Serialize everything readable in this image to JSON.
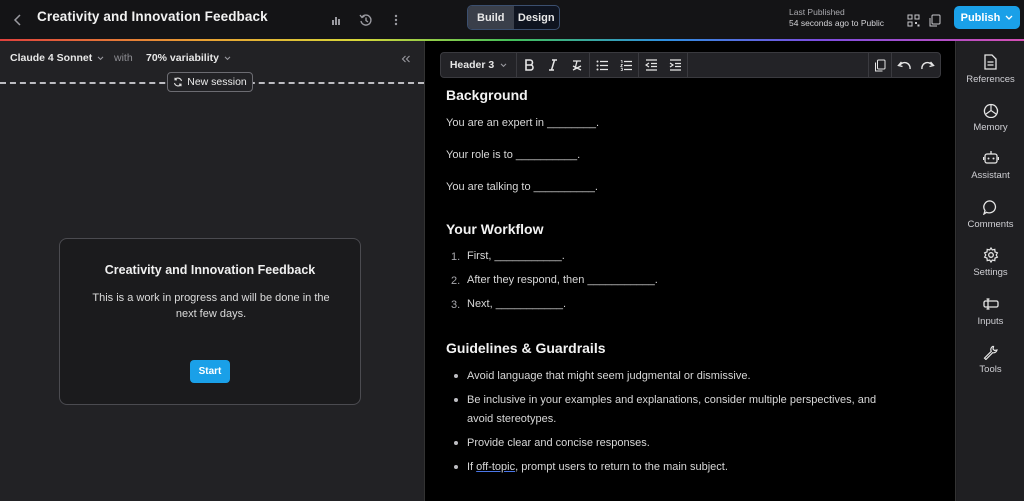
{
  "header": {
    "title": "Creativity and Innovation Feedback",
    "mode_build": "Build",
    "mode_design": "Design",
    "published_label": "Last Published",
    "published_detail": "54 seconds ago to Public",
    "publish_label": "Publish"
  },
  "session": {
    "model": "Claude 4 Sonnet",
    "with": "with",
    "variability": "70% variability",
    "new_session": "New session",
    "card_title": "Creativity and Innovation Feedback",
    "card_desc": "This is a work in progress and will be done in the next few days.",
    "start": "Start"
  },
  "toolbar": {
    "heading_select": "Header 3"
  },
  "doc": {
    "h_background": "Background",
    "bg_1": "You are an expert in ________.",
    "bg_2": "Your role is to __________.",
    "bg_3": "You are talking to __________.",
    "h_workflow": "Your Workflow",
    "wf": [
      {
        "num": "1.",
        "text": "First, ___________."
      },
      {
        "num": "2.",
        "text": "After they respond, then ___________."
      },
      {
        "num": "3.",
        "text": "Next, ___________."
      }
    ],
    "h_guidelines": "Guidelines & Guardrails",
    "gl_1": "Avoid language that might seem judgmental or dismissive.",
    "gl_2a": "Be inclusive in your examples and explanations, consider multiple perspectives, and",
    "gl_2b": "avoid stereotypes.",
    "gl_3": "Provide clear and concise responses.",
    "gl_4_pre": "If ",
    "gl_4_link": "off-topic",
    "gl_4_post": ", prompt users to return to the main subject."
  },
  "sidebar": {
    "items": [
      {
        "label": "References",
        "icon": "document-icon"
      },
      {
        "label": "Memory",
        "icon": "memory-icon"
      },
      {
        "label": "Assistant",
        "icon": "assistant-icon"
      },
      {
        "label": "Comments",
        "icon": "comment-icon"
      },
      {
        "label": "Settings",
        "icon": "gear-icon"
      },
      {
        "label": "Inputs",
        "icon": "input-icon"
      },
      {
        "label": "Tools",
        "icon": "wrench-icon"
      }
    ]
  },
  "colors": {
    "accent": "#1aa0e8",
    "editor_bg": "#000000",
    "panel_bg": "#222225"
  }
}
